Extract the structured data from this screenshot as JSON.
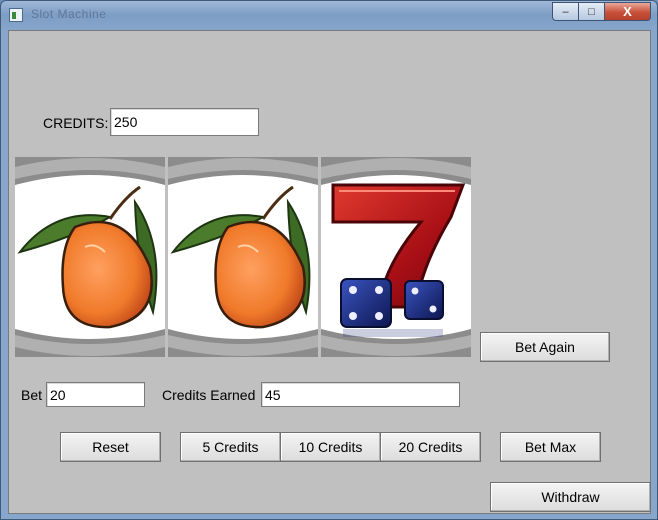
{
  "window": {
    "title": "Slot Machine",
    "controls": {
      "minimize": "–",
      "maximize": "□",
      "close": "X"
    }
  },
  "credits": {
    "label": "CREDITS:",
    "value": "250"
  },
  "reels": [
    {
      "symbol": "mango-icon"
    },
    {
      "symbol": "mango-icon"
    },
    {
      "symbol": "lucky-seven-dice-icon"
    }
  ],
  "buttons": {
    "bet_again": "Bet Again",
    "reset": "Reset",
    "five": "5 Credits",
    "ten": "10 Credits",
    "twenty": "20 Credits",
    "bet_max": "Bet Max",
    "withdraw": "Withdraw"
  },
  "bet": {
    "label": "Bet",
    "value": "20"
  },
  "earned": {
    "label": "Credits Earned",
    "value": "45"
  },
  "colors": {
    "panel": "#c0c0c0",
    "reel_border": "#9a9a9a",
    "seven_red": "#b3131b",
    "dice_blue": "#1b2b7a",
    "mango_orange": "#f08a2c",
    "leaf_green": "#3d6b26"
  }
}
